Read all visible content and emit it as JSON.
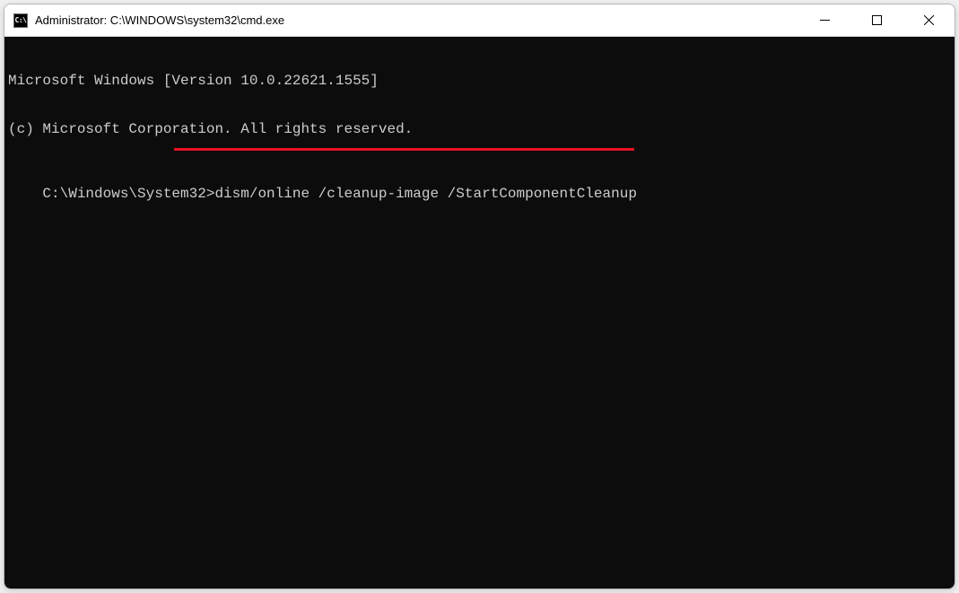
{
  "window": {
    "icon_label": "C:\\",
    "title": "Administrator: C:\\WINDOWS\\system32\\cmd.exe"
  },
  "terminal": {
    "line1": "Microsoft Windows [Version 10.0.22621.1555]",
    "line2": "(c) Microsoft Corporation. All rights reserved.",
    "blank": "",
    "prompt": "C:\\Windows\\System32>",
    "command": "dism/online /cleanup-image /StartComponentCleanup"
  },
  "annotation": {
    "underline_color": "#e81123"
  }
}
